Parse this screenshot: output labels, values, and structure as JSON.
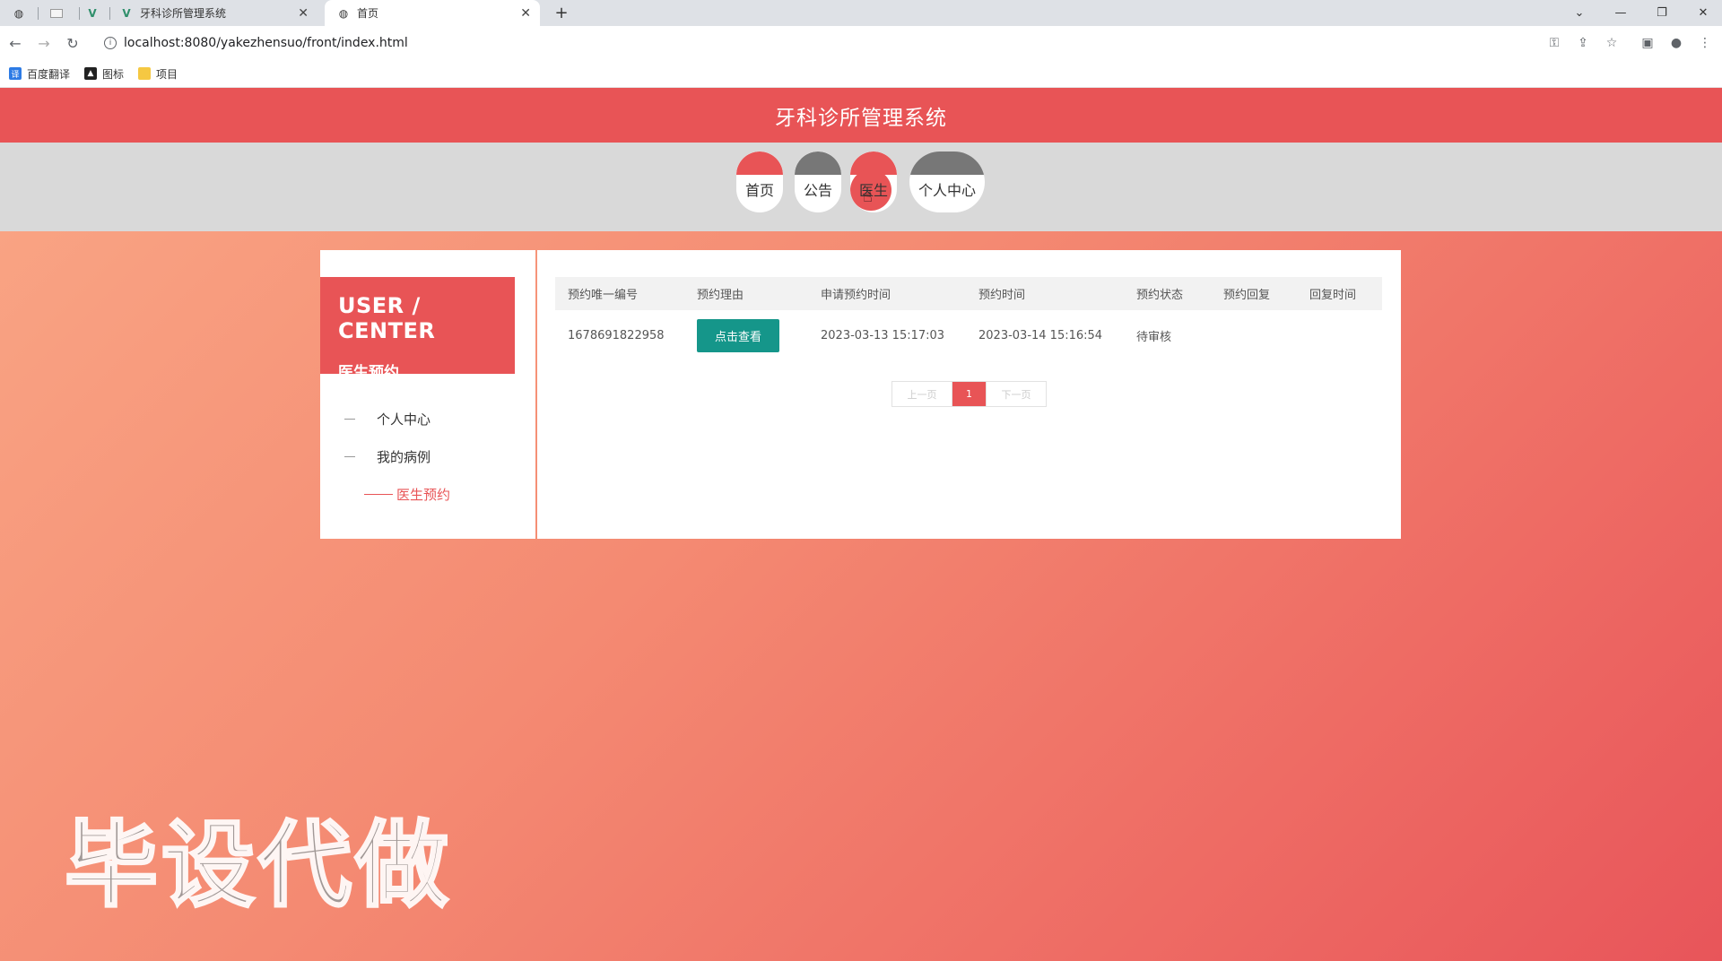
{
  "browser": {
    "tabs": [
      {
        "label": "",
        "icon": "globe-icon"
      },
      {
        "label": "",
        "icon": "blank-page-icon"
      },
      {
        "label": "",
        "icon": "vue-logo-icon"
      },
      {
        "label": "牙科诊所管理系统",
        "icon": "vue-logo-icon"
      },
      {
        "label": "首页",
        "icon": "globe-icon",
        "active": true
      }
    ],
    "url": "localhost:8080/yakezhensuo/front/index.html",
    "bookmarks": [
      {
        "label": "百度翻译"
      },
      {
        "label": "图标"
      },
      {
        "label": "项目"
      }
    ]
  },
  "site": {
    "title": "牙科诊所管理系统",
    "nav": [
      {
        "label": "首页",
        "cap_color": "#e85456"
      },
      {
        "label": "公告",
        "cap_color": "#777777"
      },
      {
        "label": "医生",
        "cap_color": "#e85456",
        "hovered": true
      },
      {
        "label": "个人中心",
        "cap_color": "#777777"
      }
    ]
  },
  "sidebar": {
    "title_en": "USER / CENTER",
    "title_cn": "医生预约",
    "items": [
      {
        "label": "个人中心"
      },
      {
        "label": "我的病例"
      },
      {
        "label": "医生预约",
        "active": true
      }
    ]
  },
  "table": {
    "headers": [
      "预约唯一编号",
      "预约理由",
      "申请预约时间",
      "预约时间",
      "预约状态",
      "预约回复",
      "回复时间"
    ],
    "rows": [
      {
        "id": "1678691822958",
        "reason_button": "点击查看",
        "apply_time": "2023-03-13 15:17:03",
        "appoint_time": "2023-03-14 15:16:54",
        "status": "待审核",
        "reply": "",
        "reply_time": ""
      }
    ]
  },
  "pager": {
    "prev": "上一页",
    "current": "1",
    "next": "下一页"
  },
  "watermark": "毕设代做",
  "colors": {
    "accent": "#e85456",
    "button_teal": "#15968a"
  }
}
